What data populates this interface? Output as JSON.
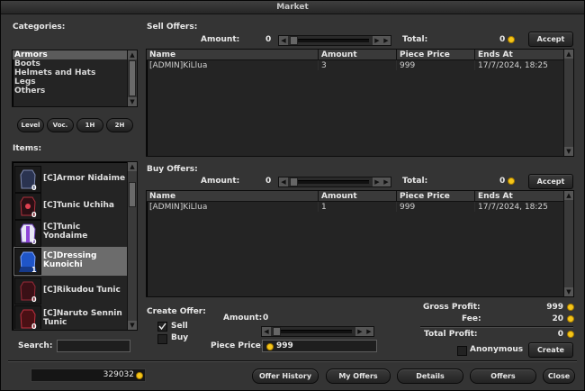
{
  "window": {
    "title": "Market"
  },
  "categories": {
    "label": "Categories:",
    "items": [
      "Armors",
      "Boots",
      "Helmets and Hats",
      "Legs",
      "Others"
    ],
    "filters": [
      "Level",
      "Voc.",
      "1H",
      "2H"
    ]
  },
  "items": {
    "label": "Items:",
    "list": [
      {
        "name": "[C]Armor Nidaime",
        "qty": "0"
      },
      {
        "name": "[C]Tunic Uchiha",
        "qty": "0"
      },
      {
        "name": "[C]Tunic Yondaime",
        "qty": "0"
      },
      {
        "name": "[C]Dressing Kunoichi",
        "qty": "1"
      },
      {
        "name": "[C]Rikudou Tunic",
        "qty": "0"
      },
      {
        "name": "[C]Naruto Sennin Tunic",
        "qty": "0"
      }
    ]
  },
  "search": {
    "label": "Search:",
    "value": ""
  },
  "balance": "329032",
  "sell": {
    "label": "Sell Offers:",
    "amount_label": "Amount:",
    "amount": "0",
    "total_label": "Total:",
    "total": "0",
    "accept": "Accept",
    "columns": [
      "Name",
      "Amount",
      "Piece Price",
      "Ends At"
    ],
    "rows": [
      [
        "[ADMIN]KiLlua",
        "3",
        "999",
        "17/7/2024, 18:25"
      ]
    ]
  },
  "buy": {
    "label": "Buy Offers:",
    "amount_label": "Amount:",
    "amount": "0",
    "total_label": "Total:",
    "total": "0",
    "accept": "Accept",
    "columns": [
      "Name",
      "Amount",
      "Piece Price",
      "Ends At"
    ],
    "rows": [
      [
        "[ADMIN]KiLlua",
        "1",
        "999",
        "17/7/2024, 18:25"
      ]
    ]
  },
  "create": {
    "label": "Create Offer:",
    "sell": "Sell",
    "buy": "Buy",
    "amount_label": "Amount:",
    "amount": "0",
    "piece_price_label": "Piece Price:",
    "piece_price": "999",
    "gross_profit_label": "Gross Profit:",
    "gross_profit": "999",
    "fee_label": "Fee:",
    "fee": "20",
    "total_profit_label": "Total Profit:",
    "total_profit": "0",
    "anonymous": "Anonymous",
    "create_button": "Create"
  },
  "footer": {
    "buttons": [
      "Offer History",
      "My Offers",
      "Details",
      "Offers",
      "Close"
    ]
  },
  "colors": {
    "coin": "#f5c518",
    "selected_item": "#6c6c6c"
  }
}
